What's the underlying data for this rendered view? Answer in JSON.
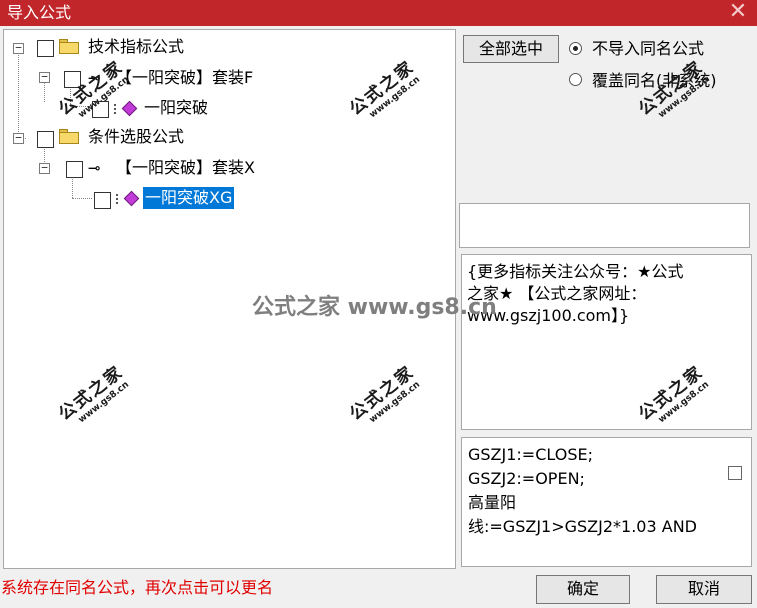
{
  "window": {
    "title": "导入公式",
    "close_glyph": "✕"
  },
  "tree": {
    "root1": {
      "label": "技术指标公式",
      "child": {
        "label": "【一阳突破】套装F",
        "leaf": "一阳突破"
      }
    },
    "root2": {
      "label": "条件选股公式",
      "child": {
        "label": "【一阳突破】套装X",
        "leaf": "一阳突破XG"
      }
    },
    "expanded_glyph": "−"
  },
  "options": {
    "select_all": "全部选中",
    "radio_skip": "不导入同名公式",
    "radio_overwrite": "覆盖同名(非系统)",
    "selected": "skip"
  },
  "description": {
    "lines": [
      "{更多指标关注公众号：★公式",
      "之家★ 【公式之家网址：",
      "www.gszj100.com】}"
    ]
  },
  "code": {
    "lines": [
      "GSZJ1:=CLOSE;",
      "GSZJ2:=OPEN;",
      "高量阳",
      "线:=GSZJ1>GSZJ2*1.03 AND"
    ]
  },
  "status": "系统存在同名公式，再次点击可以更名",
  "buttons": {
    "ok": "确定",
    "cancel": "取消"
  },
  "watermark": {
    "big": "公式之家",
    "small": "www.gs8.cn",
    "center": "公式之家 www.gs8.cn"
  },
  "colors": {
    "titlebar": "#c1262b",
    "selection": "#0078d7",
    "status": "#e00000"
  },
  "icons": {
    "folder": "folder-icon",
    "formula": "formula-gem-icon",
    "key": "key-icon"
  }
}
